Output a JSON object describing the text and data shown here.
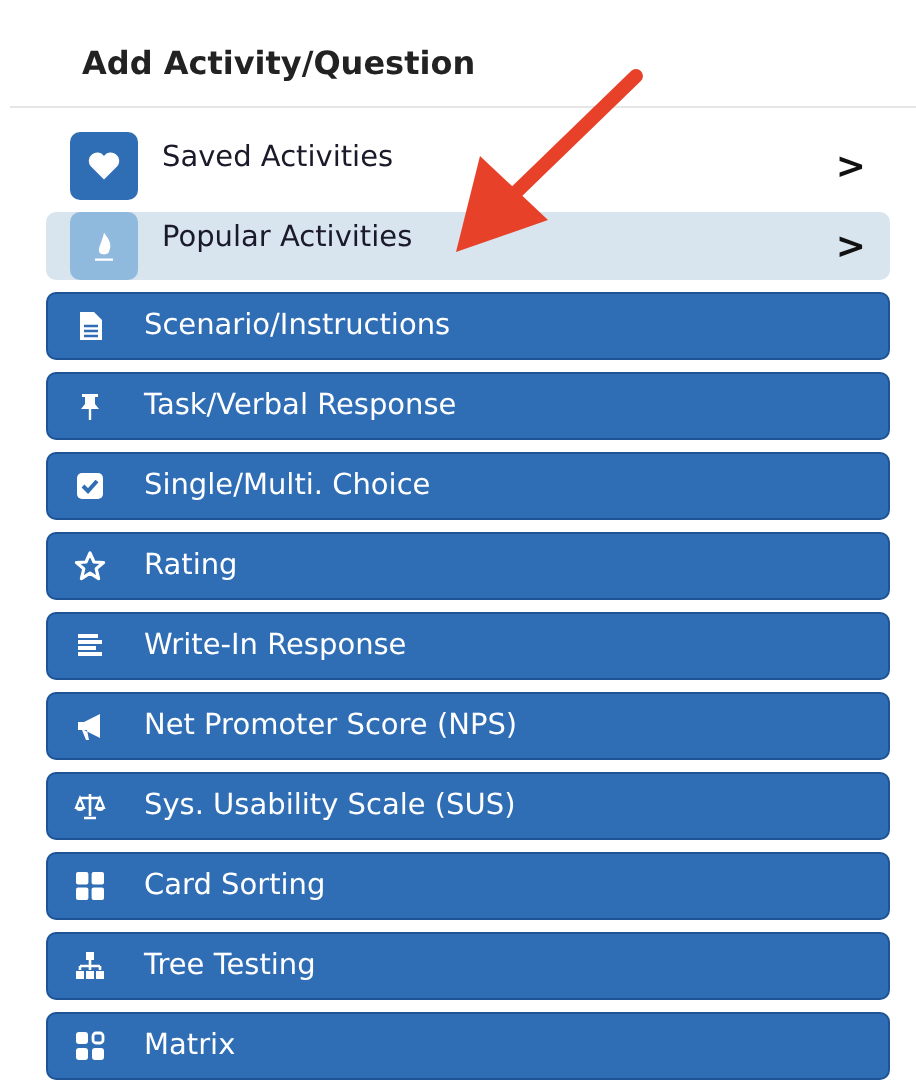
{
  "panel": {
    "title": "Add Activity/Question",
    "items": [
      {
        "kind": "nav",
        "label": "Saved Activities",
        "selected": false,
        "chevron": ">"
      },
      {
        "kind": "nav",
        "label": "Popular Activities",
        "selected": true,
        "chevron": ">"
      },
      {
        "kind": "activity",
        "label": "Scenario/Instructions"
      },
      {
        "kind": "activity",
        "label": "Task/Verbal Response"
      },
      {
        "kind": "activity",
        "label": "Single/Multi. Choice"
      },
      {
        "kind": "activity",
        "label": "Rating"
      },
      {
        "kind": "activity",
        "label": "Write-In Response"
      },
      {
        "kind": "activity",
        "label": "Net Promoter Score (NPS)"
      },
      {
        "kind": "activity",
        "label": "Sys. Usability Scale (SUS)"
      },
      {
        "kind": "activity",
        "label": "Card Sorting"
      },
      {
        "kind": "activity",
        "label": "Tree Testing"
      },
      {
        "kind": "activity",
        "label": "Matrix"
      }
    ]
  }
}
